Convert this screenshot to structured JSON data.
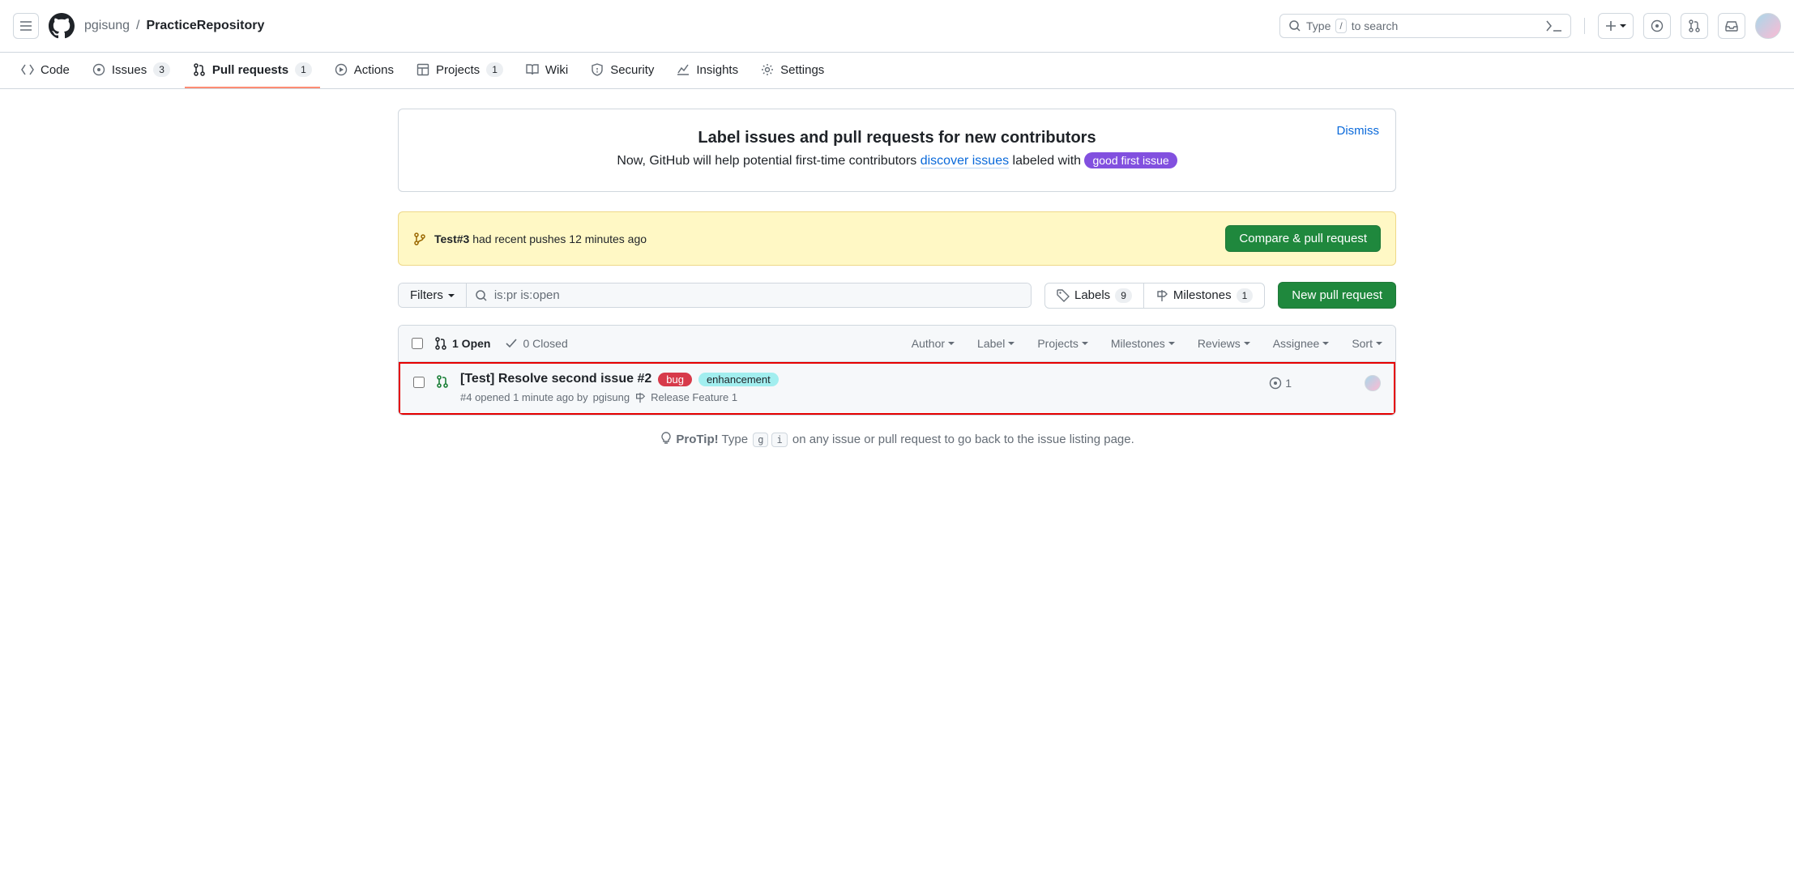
{
  "breadcrumb": {
    "owner": "pgisung",
    "repo": "PracticeRepository"
  },
  "search": {
    "placeholder_pre": "Type",
    "placeholder_key": "/",
    "placeholder_post": "to search"
  },
  "nav": {
    "code": "Code",
    "issues": "Issues",
    "issues_count": "3",
    "prs": "Pull requests",
    "prs_count": "1",
    "actions": "Actions",
    "projects": "Projects",
    "projects_count": "1",
    "wiki": "Wiki",
    "security": "Security",
    "insights": "Insights",
    "settings": "Settings"
  },
  "info": {
    "title": "Label issues and pull requests for new contributors",
    "text_pre": "Now, GitHub will help potential first-time contributors ",
    "link": "discover issues",
    "text_post": " labeled with ",
    "pill": "good first issue",
    "dismiss": "Dismiss"
  },
  "push": {
    "branch": "Test#3",
    "msg": " had recent pushes 12 minutes ago",
    "button": "Compare & pull request"
  },
  "filters": {
    "button": "Filters",
    "query": "is:pr is:open",
    "labels": "Labels",
    "labels_count": "9",
    "milestones": "Milestones",
    "milestones_count": "1",
    "new_pr": "New pull request"
  },
  "table": {
    "open": "1 Open",
    "closed": "0 Closed",
    "dd": {
      "author": "Author",
      "label": "Label",
      "projects": "Projects",
      "milestones": "Milestones",
      "reviews": "Reviews",
      "assignee": "Assignee",
      "sort": "Sort"
    }
  },
  "issue": {
    "title": "[Test] Resolve second issue #2",
    "label_bug": "bug",
    "label_enh": "enhancement",
    "meta_pre": "#4 opened 1 minute ago by ",
    "author": "pgisung",
    "milestone": "Release Feature 1",
    "reviews": "1"
  },
  "protip": {
    "bold": "ProTip!",
    "pre": " Type ",
    "k1": "g",
    "k2": "i",
    "post": " on any issue or pull request to go back to the issue listing page."
  }
}
